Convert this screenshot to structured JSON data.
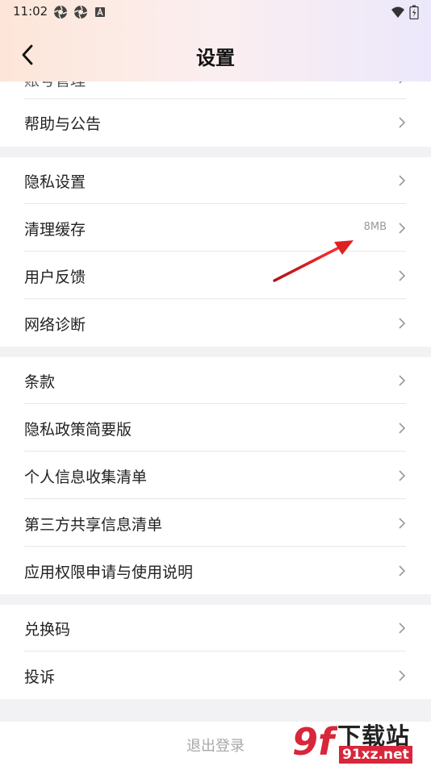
{
  "status_bar": {
    "time": "11:02",
    "icons": [
      "camera-shutter-icon",
      "camera-shutter-icon",
      "a-badge-icon",
      "wifi-icon",
      "battery-icon"
    ]
  },
  "header": {
    "title": "设置",
    "back_icon": "chevron-left-icon"
  },
  "settings": {
    "cutoff_item": "账号管理",
    "group1": [
      {
        "label": "帮助与公告"
      }
    ],
    "group2": [
      {
        "label": "隐私设置"
      },
      {
        "label": "清理缓存",
        "value": "8MB"
      },
      {
        "label": "用户反馈"
      },
      {
        "label": "网络诊断"
      }
    ],
    "group3": [
      {
        "label": "条款"
      },
      {
        "label": "隐私政策简要版"
      },
      {
        "label": "个人信息收集清单"
      },
      {
        "label": "第三方共享信息清单"
      },
      {
        "label": "应用权限申请与使用说明"
      }
    ],
    "group4": [
      {
        "label": "兑换码"
      },
      {
        "label": "投诉"
      }
    ]
  },
  "footer": {
    "logout_label": "退出登录"
  },
  "annotation": {
    "arrow_color": "#e02020"
  },
  "watermark": {
    "logo_text": "9f",
    "cn": "下载站",
    "url": "91xz.net"
  }
}
